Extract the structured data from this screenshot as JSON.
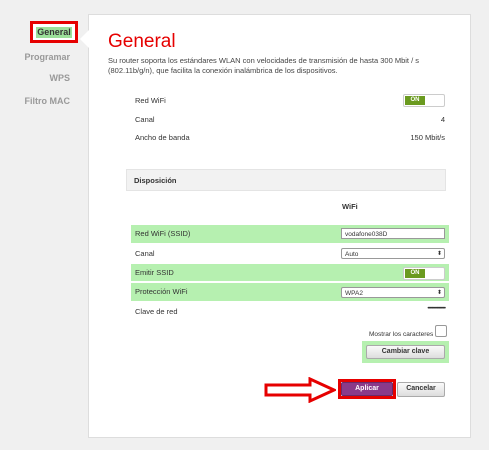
{
  "nav": {
    "items": [
      {
        "label": "General"
      },
      {
        "label": "Programar"
      },
      {
        "label": "WPS"
      },
      {
        "label": "Filtro MAC"
      }
    ]
  },
  "header": {
    "title": "General",
    "description": "Su router soporta los estándares WLAN con velocidades de transmisión de hasta 300 Mbit / s (802.11b/g/n), que facilita la conexión inalámbrica de los dispositivos."
  },
  "status": {
    "red_wifi_label": "Red WiFi",
    "red_wifi_toggle": "ON",
    "canal_label": "Canal",
    "canal_value": "4",
    "ancho_label": "Ancho de banda",
    "ancho_value": "150 Mbit/s"
  },
  "disposicion": {
    "title": "Disposición",
    "column_header": "WiFi",
    "ssid_label": "Red WiFi (SSID)",
    "ssid_value": "vodafone038D",
    "canal_label": "Canal",
    "canal_value": "Auto",
    "emitir_label": "Emitir SSID",
    "emitir_toggle": "ON",
    "proteccion_label": "Protección WiFi",
    "proteccion_value": "WPA2",
    "clave_label": "Clave de red",
    "clave_value": "••••••••••••••••",
    "mostrar_label": "Mostrar los caracteres",
    "cambiar_button": "Cambiar clave"
  },
  "actions": {
    "apply_button": "Aplicar",
    "cancel_button": "Cancelar"
  },
  "colors": {
    "brand": "#e60000",
    "highlight": "#b6f0b0",
    "toggle_on": "#6a9a1f",
    "annotation": "#e60000"
  }
}
